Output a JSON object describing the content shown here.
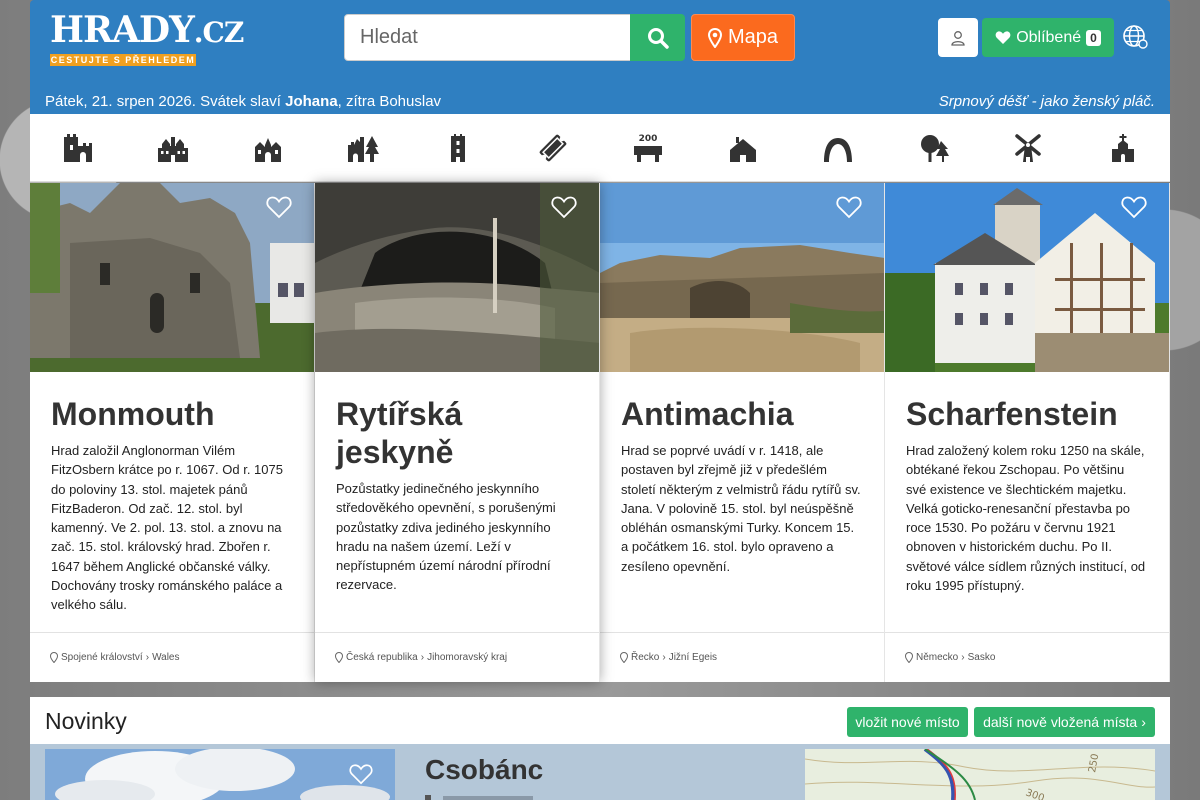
{
  "logo": {
    "main": "HRADY",
    "tld": ".CZ",
    "tagline": "CESTUJTE S PŘEHLEDEM"
  },
  "search": {
    "placeholder": "Hledat"
  },
  "map_button": {
    "label": "Mapa"
  },
  "favorites": {
    "label": "Oblíbené",
    "count": "0"
  },
  "date_line": {
    "prefix": "Pátek, 21. srpen 2026. Svátek slaví ",
    "name": "Johana",
    "suffix": ", zítra Bohuslav"
  },
  "proverb": "Srpnový déšť - jako ženský pláč.",
  "categories": [
    "castle",
    "chateau",
    "church",
    "ruin",
    "tower",
    "museum",
    "zoo",
    "cottage",
    "cave",
    "nature",
    "windmill",
    "chapel"
  ],
  "cards": [
    {
      "title": "Monmouth",
      "text": "Hrad založil Anglonorman Vilém FitzOsbern krátce po r. 1067. Od r. 1075 do poloviny 13. stol. majetek pánů FitzBaderon. Od zač. 12. stol. byl kamenný. Ve 2. pol. 13. stol. a znovu na zač. 15. stol. královský hrad. Zbořen r. 1647 během Anglické občanské války. Dochovány trosky románského paláce a velkého sálu.",
      "country": "Spojené království",
      "region": "Wales"
    },
    {
      "title": "Rytířská jeskyně",
      "text": "Pozůstatky jedinečného jeskynního středověkého opevnění, s porušenými pozůstatky zdiva jediného jeskynního hradu na našem území. Leží v nepřístupném území národní přírodní rezervace.",
      "country": "Česká republika",
      "region": "Jihomoravský kraj"
    },
    {
      "title": "Antimachia",
      "text": "Hrad se poprvé uvádí v r. 1418, ale postaven byl zřejmě již v předešlém století některým z velmistrů řádu rytířů sv. Jana. V polovině 15. stol. byl neúspěšně obléhán osmanskými Turky. Koncem 15. a počátkem 16. stol. bylo opraveno a zesíleno opevnění.",
      "country": "Řecko",
      "region": "Jižní Egeis"
    },
    {
      "title": "Scharfenstein",
      "text": "Hrad založený kolem roku 1250 na skále, obtékané řekou Zschopau. Po většinu své existence ve šlechtickém majetku. Velká goticko-renesanční přestavba po roce 1530. Po požáru v červnu 1921 obnoven v historickém duchu. Po II. světové válce sídlem různých institucí, od roku 1995 přístupný.",
      "country": "Německo",
      "region": "Sasko"
    }
  ],
  "news": {
    "title": "Novinky",
    "add_label": "vložit nové místo",
    "more_label": "další nově vložená místa",
    "item_title": "Csobánc"
  }
}
